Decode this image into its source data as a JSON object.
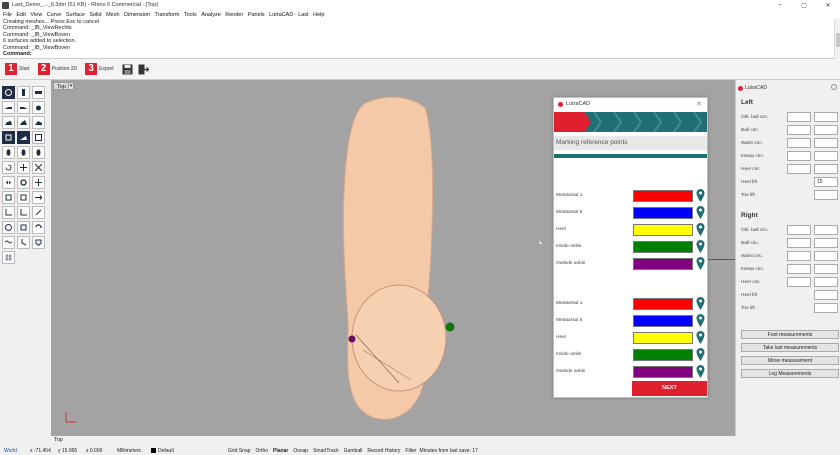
{
  "window": {
    "title": "Last_Demo_..._6.3dm (51 KB) - Rhino 6 Commercial - [Top]",
    "controls": [
      "–",
      "▢",
      "✕"
    ]
  },
  "menu": [
    "File",
    "Edit",
    "View",
    "Curve",
    "Surface",
    "Solid",
    "Mesh",
    "Dimension",
    "Transform",
    "Tools",
    "Analyze",
    "Render",
    "Panels",
    "LutraCAD - Last",
    "Help"
  ],
  "command": {
    "lines": [
      "Creating meshes... Press Esc to cancel",
      "Command: _IB_ViewRechts",
      "Command: _IB_ViewBoven",
      "6 surfaces added to selection.",
      "Command: _IB_ViewBoven"
    ],
    "prompt": "Command:"
  },
  "steps": [
    {
      "num": "1",
      "label": "Start"
    },
    {
      "num": "2",
      "label": "Position 2D"
    },
    {
      "num": "3",
      "label": "Export"
    }
  ],
  "viewport": {
    "tab": "Top",
    "dropdown": "▾"
  },
  "dialog": {
    "title": "LutraCAD",
    "close": "✕",
    "section": "Marking reference points",
    "left_points": [
      {
        "name": "Metatarsal 1",
        "color": "#ff0000"
      },
      {
        "name": "Metatarsal 5",
        "color": "#0000ff"
      },
      {
        "name": "Heel",
        "color": "#ffff00"
      },
      {
        "name": "Inside ankle",
        "color": "#008000"
      },
      {
        "name": "Outside ankle",
        "color": "#800080"
      }
    ],
    "right_points": [
      {
        "name": "Metatarsal 1",
        "color": "#ff0000"
      },
      {
        "name": "Metatarsal 5",
        "color": "#0000ff"
      },
      {
        "name": "Heel",
        "color": "#ffff00"
      },
      {
        "name": "Inside ankle",
        "color": "#008000"
      },
      {
        "name": "Outside ankle",
        "color": "#800080"
      }
    ],
    "next_label": "NEXT",
    "accent": "#e0202e",
    "teal": "#1f6f74"
  },
  "panel": {
    "title": "LutraCAD",
    "left_title": "Left",
    "left_rows": [
      {
        "name": "Obl. ball circ.",
        "v1": "",
        "v2": "",
        "two": true
      },
      {
        "name": "Ball circ.",
        "v1": "",
        "v2": "",
        "two": true
      },
      {
        "name": "Waist circ.",
        "v1": "",
        "v2": "",
        "two": true
      },
      {
        "name": "Instep circ.",
        "v1": "",
        "v2": "",
        "two": true
      },
      {
        "name": "Heel circ.",
        "v1": "",
        "v2": "",
        "two": true
      },
      {
        "name": "Heel lift",
        "v1": "15",
        "two": false
      },
      {
        "name": "Toe lift",
        "v1": "",
        "two": false
      }
    ],
    "right_title": "Right",
    "right_rows": [
      {
        "name": "Obl. ball circ.",
        "v1": "",
        "v2": "",
        "two": true
      },
      {
        "name": "Ball circ.",
        "v1": "",
        "v2": "",
        "two": true
      },
      {
        "name": "Waist circ.",
        "v1": "",
        "v2": "",
        "two": true
      },
      {
        "name": "Instep circ.",
        "v1": "",
        "v2": "",
        "two": true
      },
      {
        "name": "Heel circ.",
        "v1": "",
        "v2": "",
        "two": true
      },
      {
        "name": "Heel lift",
        "v1": "",
        "two": false
      },
      {
        "name": "Toe lift",
        "v1": "",
        "two": false
      }
    ],
    "buttons": [
      "Foot measurements",
      "Take last measurements",
      "Move measurement",
      "Log Measurements"
    ]
  },
  "status": {
    "tab": "Top",
    "world": "World",
    "x": "x -71.454",
    "y": "y 15.965",
    "z": "z 0.000",
    "units": "Millimeters",
    "layer": "Default",
    "toggles": [
      "Grid Snap",
      "Ortho",
      "Planar",
      "Osnap",
      "SmartTrack",
      "Gumball",
      "Record History",
      "Filter"
    ],
    "save": "Minutes from last save: 17"
  }
}
